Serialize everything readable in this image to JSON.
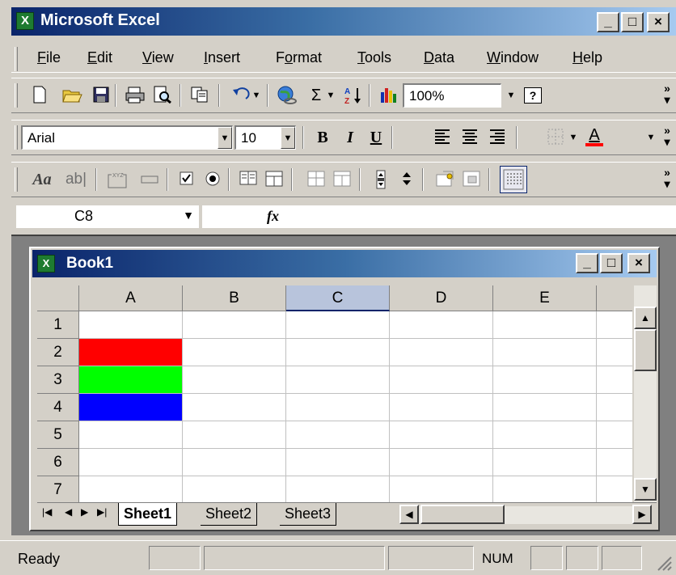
{
  "app": {
    "title": "Microsoft Excel",
    "icon": "excel-app-icon"
  },
  "caption_buttons": {
    "minimize": "_",
    "maximize": "□",
    "close": "×"
  },
  "menu": [
    {
      "label": "File",
      "key": "F",
      "rest": "ile"
    },
    {
      "label": "Edit",
      "key": "E",
      "rest": "dit"
    },
    {
      "label": "View",
      "key": "V",
      "rest": "iew"
    },
    {
      "label": "Insert",
      "key": "I",
      "rest": "nsert"
    },
    {
      "label": "Format",
      "pre": "F",
      "key": "o",
      "rest": "rmat"
    },
    {
      "label": "Tools",
      "key": "T",
      "rest": "ools"
    },
    {
      "label": "Data",
      "key": "D",
      "rest": "ata"
    },
    {
      "label": "Window",
      "key": "W",
      "rest": "indow"
    },
    {
      "label": "Help",
      "key": "H",
      "rest": "elp"
    }
  ],
  "standard_toolbar": {
    "zoom": "100%",
    "help_label": "?"
  },
  "formatting_toolbar": {
    "font": "Arial",
    "size": "10",
    "bold": "B",
    "italic": "I",
    "underline": "U",
    "font_color": "A",
    "font_color_value": "#ff0000"
  },
  "forms_toolbar": {
    "label_tool": "Aa",
    "edit_tool": "ab|",
    "group_tool": "XYZ"
  },
  "formula_bar": {
    "name_box": "C8",
    "fx": "fx",
    "value": ""
  },
  "workbook": {
    "title": "Book1",
    "columns": [
      "A",
      "B",
      "C",
      "D",
      "E"
    ],
    "selected_column": "C",
    "rows": [
      "1",
      "2",
      "3",
      "4",
      "5",
      "6",
      "7"
    ],
    "colored_cells": [
      {
        "cell": "A2",
        "color": "#ff0000"
      },
      {
        "cell": "A3",
        "color": "#00ff00"
      },
      {
        "cell": "A4",
        "color": "#0000ff"
      }
    ],
    "tabs": [
      "Sheet1",
      "Sheet2",
      "Sheet3"
    ],
    "active_tab": "Sheet1"
  },
  "status": {
    "text": "Ready",
    "num": "NUM"
  }
}
